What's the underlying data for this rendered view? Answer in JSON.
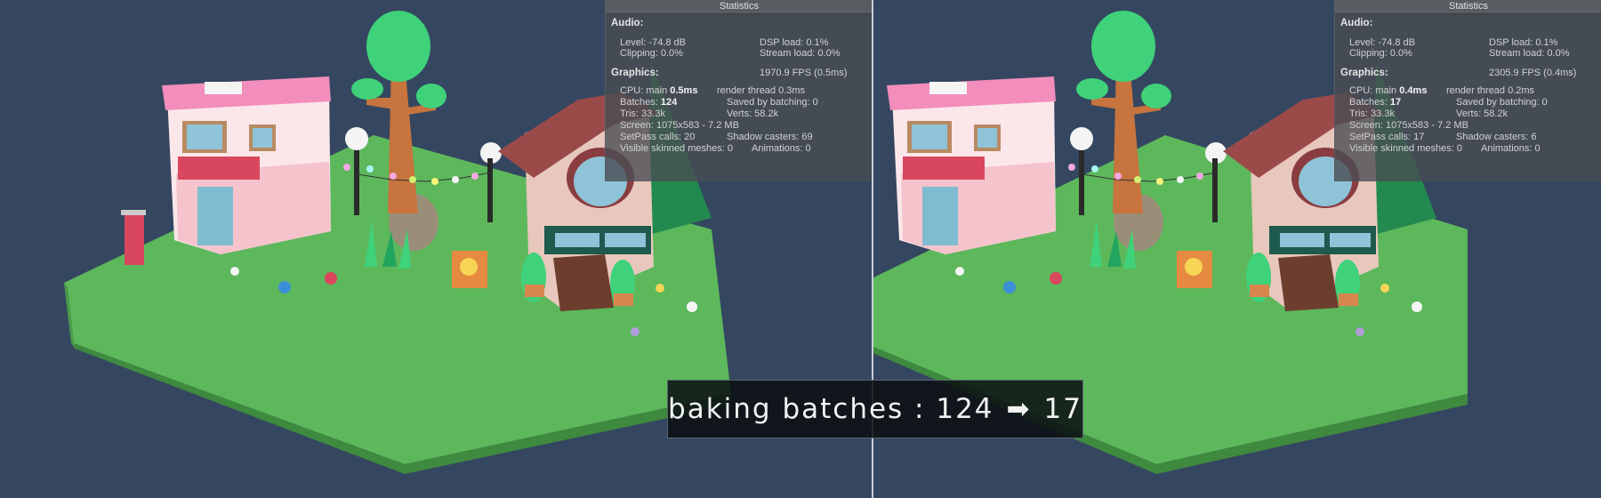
{
  "left": {
    "stats": {
      "title": "Statistics",
      "audio_label": "Audio:",
      "level": "Level: -74.8 dB",
      "dsp_load": "DSP load: 0.1%",
      "clipping": "Clipping: 0.0%",
      "stream_load": "Stream load: 0.0%",
      "graphics_label": "Graphics:",
      "fps": "1970.9 FPS (0.5ms)",
      "cpu_main_prefix": "CPU: main ",
      "cpu_main_value": "0.5ms",
      "render_thread": "render thread 0.3ms",
      "batches_prefix": "Batches: ",
      "batches_value": "124",
      "saved_by_batching": "Saved by batching: 0",
      "tris": "Tris: 33.3k",
      "verts": "Verts: 58.2k",
      "screen": "Screen: 1075x583 - 7.2 MB",
      "setpass": "SetPass calls: 20",
      "shadow_casters": "Shadow casters: 69",
      "skinned_meshes": "Visible skinned meshes: 0",
      "animations": "Animations: 0"
    }
  },
  "right": {
    "stats": {
      "title": "Statistics",
      "audio_label": "Audio:",
      "level": "Level: -74.8 dB",
      "dsp_load": "DSP load: 0.1%",
      "clipping": "Clipping: 0.0%",
      "stream_load": "Stream load: 0.0%",
      "graphics_label": "Graphics:",
      "fps": "2305.9 FPS (0.4ms)",
      "cpu_main_prefix": "CPU: main ",
      "cpu_main_value": "0.4ms",
      "render_thread": "render thread 0.2ms",
      "batches_prefix": "Batches: ",
      "batches_value": "17",
      "saved_by_batching": "Saved by batching: 0",
      "tris": "Tris: 33.3k",
      "verts": "Verts: 58.2k",
      "screen": "Screen: 1075x583 - 7.2 MB",
      "setpass": "SetPass calls: 17",
      "shadow_casters": "Shadow casters: 6",
      "skinned_meshes": "Visible skinned meshes: 0",
      "animations": "Animations: 0"
    }
  },
  "caption": {
    "prefix": "baking batches : 124",
    "arrow": "➡",
    "suffix": "17"
  },
  "colors": {
    "background": "#354760",
    "grass": "#5db85c",
    "house_pink": "#f29cc0",
    "tree": "#3fd27a"
  }
}
